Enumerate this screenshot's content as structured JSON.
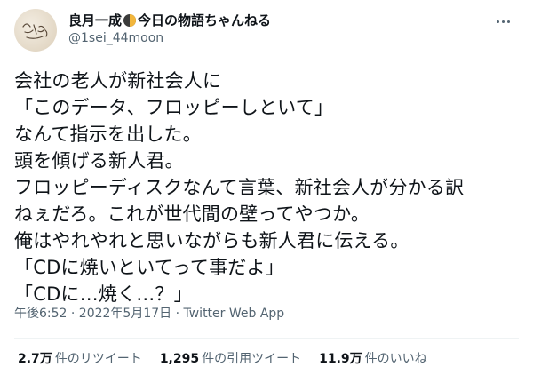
{
  "user": {
    "display_name_prefix": "良月一成",
    "display_name_suffix": "今日の物語ちゃんねる",
    "handle": "@1sei_44moon",
    "name_icon": "half-moon-icon"
  },
  "tweet": {
    "lines": [
      "会社の老人が新社会人に",
      "「このデータ、フロッピーしといて」",
      "なんて指示を出した。",
      "頭を傾げる新人君。",
      "フロッピーディスクなんて言葉、新社会人が分かる訳",
      "ねぇだろ。これが世代間の壁ってやつか。",
      "俺はやれやれと思いながらも新人君に伝える。",
      "「CDに焼いといてって事だよ」",
      "「CDに…焼く…？」"
    ]
  },
  "meta": {
    "text": "午後6:52 · 2022年5月17日 · Twitter Web App"
  },
  "stats": [
    {
      "count": "2.7万",
      "label": "件のリツイート"
    },
    {
      "count": "1,295",
      "label": "件の引用ツイート"
    },
    {
      "count": "11.9万",
      "label": "件のいいね"
    }
  ],
  "colors": {
    "text": "#0f1419",
    "secondary": "#536471",
    "divider": "#eff3f4"
  }
}
